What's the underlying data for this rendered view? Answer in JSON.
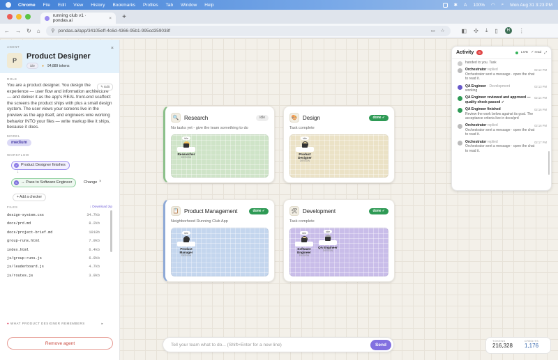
{
  "menubar": {
    "items": [
      "Chrome",
      "File",
      "Edit",
      "View",
      "History",
      "Bookmarks",
      "Profiles",
      "Tab",
      "Window",
      "Help"
    ],
    "battery": "100%",
    "datetime": "Mon Aug 31  3:23 PM"
  },
  "browser": {
    "tab_title": "running club v1 · pondas.ai",
    "url": "pondas.ai/app/34105eff-4c6d-4366-95b1-995cd359038f",
    "profile_initial": "H"
  },
  "agent_panel": {
    "section_label": "AGENT",
    "avatar_initial": "P",
    "name": "Product Designer",
    "status": "idle",
    "tokens": "94,889 tokens",
    "role_label": "ROLE",
    "edit_label": "✎ Edit",
    "role_text": "You are a product designer. You design the experience — user flow and information architecture — and deliver it as the app's REAL front-end scaffold: the screens the product ships with plus a small design system. The user views your screens live in the preview as the app itself, and engineers wire working behavior INTO your files — write markup like it ships, because it does.",
    "model_label": "MODEL",
    "model": "medium",
    "workflow_label": "WORKFLOW",
    "workflow_step1": "Product Designer finishes",
    "workflow_step2": "→ Pass to Software Engineer",
    "change_label": "Change",
    "add_checker_label": "+ Add a checker",
    "files_label": "FILES",
    "download_label": "↓ Download zip",
    "files": [
      {
        "name": "design-system.css",
        "size": "34.7kb"
      },
      {
        "name": "docs/prd.md",
        "size": "8.2kb"
      },
      {
        "name": "docs/project-brief.md",
        "size": "1018b"
      },
      {
        "name": "group-runs.html",
        "size": "7.9kb"
      },
      {
        "name": "index.html",
        "size": "6.4kb"
      },
      {
        "name": "js/group-runs.js",
        "size": "6.9kb"
      },
      {
        "name": "js/leaderboard.js",
        "size": "4.7kb"
      },
      {
        "name": "js/routes.js",
        "size": "3.9kb"
      }
    ],
    "remembers_label": "WHAT PRODUCT DESIGNER REMEMBERS",
    "remove_label": "Remove agent"
  },
  "cards": {
    "research": {
      "title": "Research",
      "status": "idle",
      "subtitle": "No tasks yet - give the team something to do",
      "worker_tag": "idle",
      "worker_name": "Researcher",
      "worker_state": "DESIGN"
    },
    "design": {
      "title": "Design",
      "status": "done ✓",
      "subtitle": "Task complete",
      "worker_tag": "idle",
      "worker_name": "Product Designer",
      "worker_state": "DESIGN"
    },
    "product": {
      "title": "Product Management",
      "status": "done ✓",
      "subtitle": "Neighborhood Running Club App",
      "worker_tag": "idle",
      "worker_name": "Product Manager",
      "worker_state": "DESIGN"
    },
    "development": {
      "title": "Development",
      "status": "done ✓",
      "subtitle": "Task complete",
      "worker1_tag": "idle",
      "worker1_name": "Software Engineer",
      "worker1_state": "DESIGN",
      "worker2_tag": "idle",
      "worker2_name": "QA Engineer",
      "worker2_state": "DESIGN"
    }
  },
  "activity": {
    "title": "Activity",
    "count": "6",
    "live": "LIVE",
    "read": "✓ read",
    "events": [
      {
        "who": "",
        "tag": "",
        "msg": "handed to you. Task",
        "time": "",
        "color": "#cccccc"
      },
      {
        "who": "Orchestrator",
        "tag": "replied",
        "msg": "Orchestrator sent a message · open the chat to read it.",
        "time": "02:12 PM",
        "color": "#bbbbbb"
      },
      {
        "who": "QA Engineer",
        "tag": "· Development",
        "msg": "working",
        "time": "02:13 PM",
        "color": "#6757c9"
      },
      {
        "who": "QA Engineer reviewed and approved — quality check passed ✓",
        "tag": "",
        "msg": "",
        "time": "02:14 PM",
        "color": "#2e9a55"
      },
      {
        "who": "QA Engineer finished",
        "tag": "",
        "msg": "Review the work below against its goal. The acceptance criteria live in docs/prd",
        "time": "02:16 PM",
        "color": "#2e9a55"
      },
      {
        "who": "Orchestrator",
        "tag": "replied",
        "msg": "Orchestrator sent a message · open the chat to read it.",
        "time": "02:16 PM",
        "color": "#bbbbbb"
      },
      {
        "who": "Orchestrator",
        "tag": "replied",
        "msg": "Orchestrator sent a message · open the chat to read it.",
        "time": "02:17 PM",
        "color": "#bbbbbb"
      }
    ]
  },
  "composer": {
    "placeholder": "Tell your team what to do... (Shift+Enter for a new line)",
    "send_label": "Send"
  },
  "stats": {
    "tokens_label": "TOKENS",
    "tokens": "216,328",
    "credits_label": "CREDITS",
    "credits": "1,176"
  },
  "colors": {
    "accent": "#8270e0",
    "done": "#2e9a55",
    "danger": "#c9483d"
  }
}
